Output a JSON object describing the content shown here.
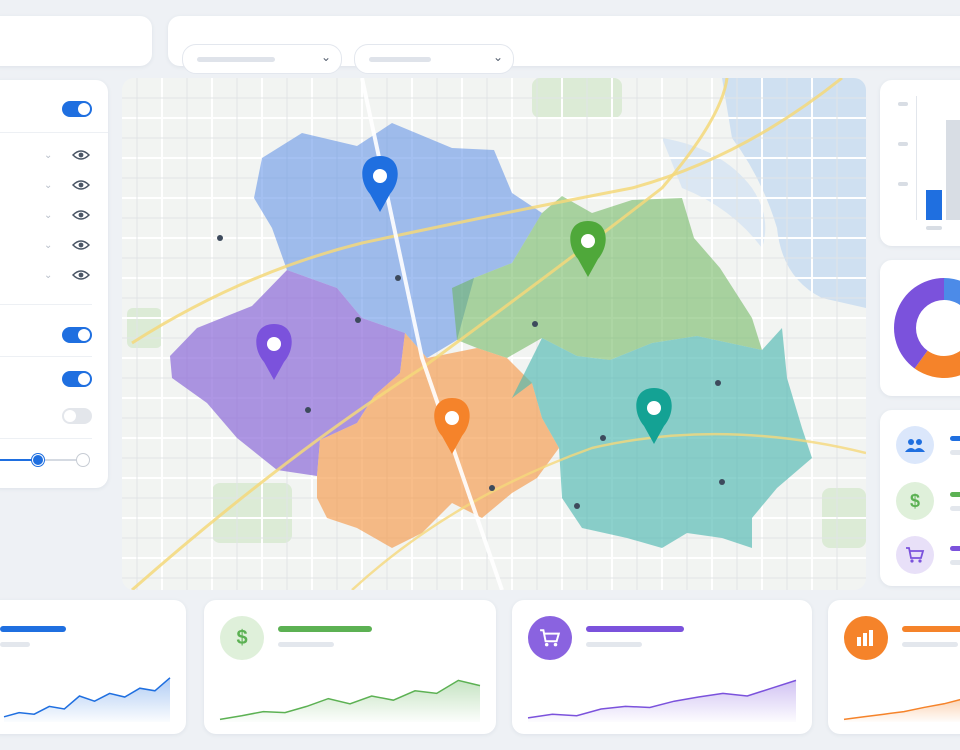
{
  "colors": {
    "blue": "#1f6fe0",
    "green": "#5cb153",
    "purple": "#7b52dc",
    "orange": "#f5832a",
    "teal": "#14a294"
  },
  "topbar": {
    "filters": [
      {
        "icon": "chevron-down-icon"
      },
      {
        "icon": "chevron-down-icon"
      }
    ]
  },
  "layers_panel": {
    "main_toggle": {
      "on": true
    },
    "layer_rows": [
      {
        "icon": "eye-icon"
      },
      {
        "icon": "eye-icon"
      },
      {
        "icon": "eye-icon"
      },
      {
        "icon": "eye-icon"
      },
      {
        "icon": "eye-icon"
      }
    ],
    "option_toggles": [
      {
        "on": true
      },
      {
        "on": true
      },
      {
        "on": false
      }
    ],
    "slider": {
      "value": 0.55
    }
  },
  "map": {
    "regions": [
      {
        "name": "region-blue",
        "color": "#5a8ce6"
      },
      {
        "name": "region-green",
        "color": "#6ab55a"
      },
      {
        "name": "region-purple",
        "color": "#8c6ad8"
      },
      {
        "name": "region-orange",
        "color": "#f59a4a"
      },
      {
        "name": "region-teal",
        "color": "#4fb8b0"
      }
    ],
    "pins": [
      {
        "icon": "map-pin-icon",
        "color": "#1f6fe0"
      },
      {
        "icon": "map-pin-icon",
        "color": "#4fa83a"
      },
      {
        "icon": "map-pin-icon",
        "color": "#7b52dc"
      },
      {
        "icon": "map-pin-icon",
        "color": "#f5832a"
      },
      {
        "icon": "map-pin-icon",
        "color": "#14a294"
      }
    ]
  },
  "right_panel": {
    "donut_segments": [
      {
        "color": "#4c8be8",
        "share": 0.25
      },
      {
        "color": "#21a38f",
        "share": 0.1
      },
      {
        "color": "#f5832a",
        "share": 0.25
      },
      {
        "color": "#7b52dc",
        "share": 0.4
      }
    ],
    "legend": [
      {
        "icon": "users-icon",
        "color": "#1f6fe0",
        "bg": "#dbe7fb"
      },
      {
        "icon": "dollar-icon",
        "glyph": "$",
        "color": "#5cb153",
        "bg": "#dff0da"
      },
      {
        "icon": "cart-icon",
        "color": "#7b52dc",
        "bg": "#e8e0f8"
      }
    ]
  },
  "kpi_cards": [
    {
      "icon": "",
      "color": "#1f6fe0",
      "spark": [
        0.1,
        0.18,
        0.15,
        0.3,
        0.25,
        0.5,
        0.4,
        0.55,
        0.48,
        0.65,
        0.6,
        0.85
      ]
    },
    {
      "icon": "dollar-icon",
      "glyph": "$",
      "color": "#5cb153",
      "spark": [
        0.05,
        0.12,
        0.2,
        0.18,
        0.3,
        0.45,
        0.35,
        0.5,
        0.42,
        0.6,
        0.55,
        0.8,
        0.7
      ]
    },
    {
      "icon": "cart-icon",
      "color": "#7b52dc",
      "spark": [
        0.08,
        0.15,
        0.12,
        0.25,
        0.3,
        0.28,
        0.4,
        0.48,
        0.55,
        0.5,
        0.65,
        0.8
      ]
    },
    {
      "icon": "chart-icon",
      "color": "#f5832a",
      "spark": [
        0.05,
        0.1,
        0.15,
        0.2,
        0.28,
        0.35,
        0.45
      ]
    }
  ]
}
